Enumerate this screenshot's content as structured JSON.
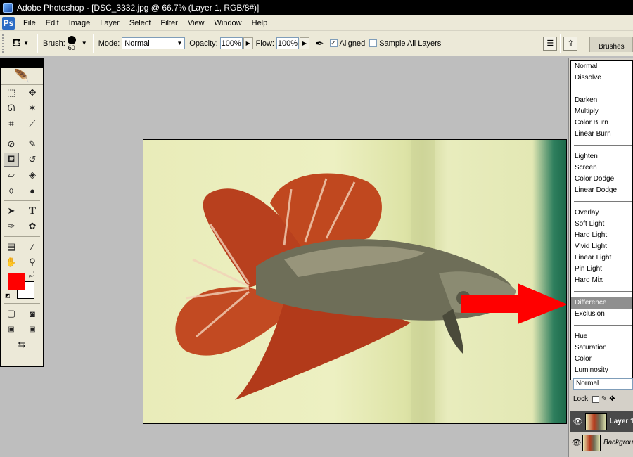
{
  "window": {
    "title": "Adobe Photoshop - [DSC_3332.jpg @ 66.7% (Layer 1, RGB/8#)]"
  },
  "menu": [
    "File",
    "Edit",
    "Image",
    "Layer",
    "Select",
    "Filter",
    "View",
    "Window",
    "Help"
  ],
  "options": {
    "brush_label": "Brush:",
    "brush_size": "60",
    "mode_label": "Mode:",
    "mode_value": "Normal",
    "opacity_label": "Opacity:",
    "opacity_value": "100%",
    "flow_label": "Flow:",
    "flow_value": "100%",
    "aligned_label": "Aligned",
    "aligned_checked": true,
    "sample_all_label": "Sample All Layers",
    "sample_all_checked": false
  },
  "palette_well": {
    "brushes_tab": "Brushes"
  },
  "toolbox": {
    "foreground_color": "#ff0000",
    "background_color": "#ffffff",
    "tools": [
      [
        "marquee-icon",
        "move-icon"
      ],
      [
        "lasso-icon",
        "magic-wand-icon"
      ],
      [
        "crop-icon",
        "slice-icon"
      ],
      [
        "healing-brush-icon",
        "brush-icon"
      ],
      [
        "clone-stamp-icon",
        "history-brush-icon"
      ],
      [
        "eraser-icon",
        "paint-bucket-icon"
      ],
      [
        "blur-icon",
        "dodge-icon"
      ],
      [
        "path-selection-icon",
        "type-icon"
      ],
      [
        "pen-icon",
        "custom-shape-icon"
      ],
      [
        "notes-icon",
        "eyedropper-icon"
      ],
      [
        "hand-icon",
        "zoom-icon"
      ]
    ],
    "active_tool": "clone-stamp-icon"
  },
  "blend_modes": {
    "groups": [
      [
        "Normal",
        "Dissolve"
      ],
      [
        "Darken",
        "Multiply",
        "Color Burn",
        "Linear Burn"
      ],
      [
        "Lighten",
        "Screen",
        "Color Dodge",
        "Linear Dodge"
      ],
      [
        "Overlay",
        "Soft Light",
        "Hard Light",
        "Vivid Light",
        "Linear Light",
        "Pin Light",
        "Hard Mix"
      ],
      [
        "Difference",
        "Exclusion"
      ],
      [
        "Hue",
        "Saturation",
        "Color",
        "Luminosity"
      ]
    ],
    "selected": "Difference"
  },
  "layers_panel": {
    "mode_value": "Normal",
    "lock_label": "Lock:",
    "layers": [
      {
        "name": "Layer 1",
        "selected": true
      },
      {
        "name": "Background",
        "selected": false
      }
    ]
  },
  "annotation": {
    "arrow_color": "#ff0000"
  }
}
